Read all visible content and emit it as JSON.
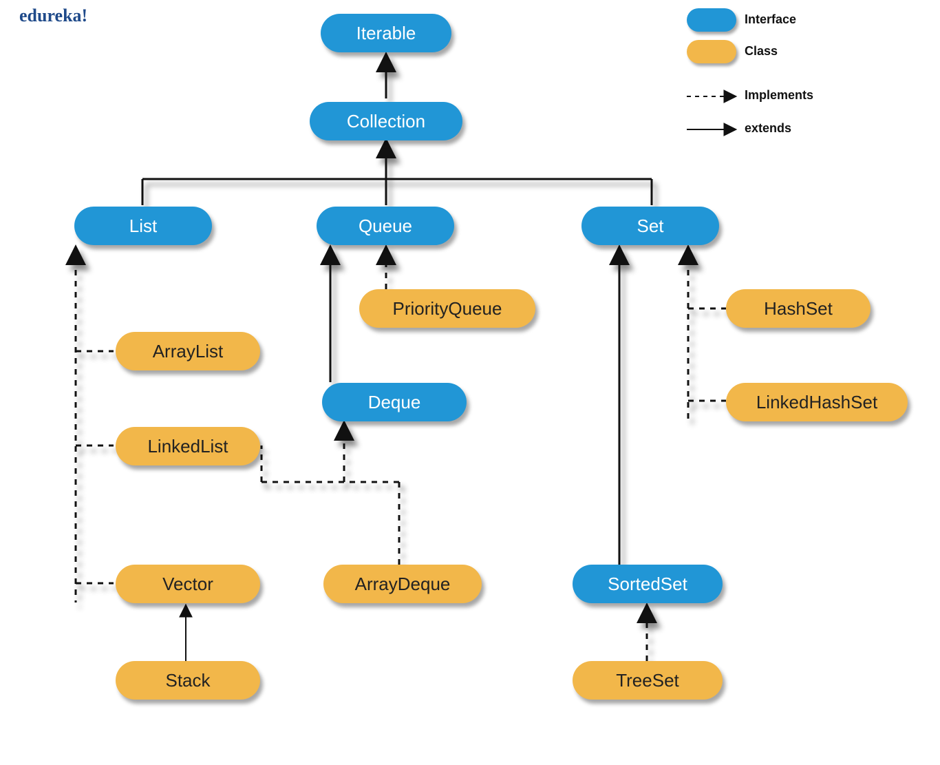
{
  "brand": "edureka!",
  "watermark_text": "edureka!",
  "legend": {
    "interface": "Interface",
    "class": "Class",
    "implements": "Implements",
    "extends": "extends"
  },
  "nodes": {
    "iterable": "Iterable",
    "collection": "Collection",
    "list": "List",
    "queue": "Queue",
    "set": "Set",
    "arraylist": "ArrayList",
    "linkedlist": "LinkedList",
    "vector": "Vector",
    "stack": "Stack",
    "priorityqueue": "PriorityQueue",
    "deque": "Deque",
    "arraydeque": "ArrayDeque",
    "sortedset": "SortedSet",
    "hashset": "HashSet",
    "linkedhashset": "LinkedHashSet",
    "treeset": "TreeSet"
  },
  "colors": {
    "interface": "#2196d6",
    "class": "#f2b74a"
  },
  "edges": [
    {
      "from": "collection",
      "to": "iterable",
      "kind": "extends"
    },
    {
      "from": "list",
      "to": "collection",
      "kind": "extends"
    },
    {
      "from": "queue",
      "to": "collection",
      "kind": "extends"
    },
    {
      "from": "set",
      "to": "collection",
      "kind": "extends"
    },
    {
      "from": "arraylist",
      "to": "list",
      "kind": "implements"
    },
    {
      "from": "linkedlist",
      "to": "list",
      "kind": "implements"
    },
    {
      "from": "vector",
      "to": "list",
      "kind": "implements"
    },
    {
      "from": "stack",
      "to": "vector",
      "kind": "extends"
    },
    {
      "from": "priorityqueue",
      "to": "queue",
      "kind": "implements"
    },
    {
      "from": "deque",
      "to": "queue",
      "kind": "extends"
    },
    {
      "from": "linkedlist",
      "to": "deque",
      "kind": "implements"
    },
    {
      "from": "arraydeque",
      "to": "deque",
      "kind": "implements"
    },
    {
      "from": "hashset",
      "to": "set",
      "kind": "implements"
    },
    {
      "from": "linkedhashset",
      "to": "set",
      "kind": "implements"
    },
    {
      "from": "sortedset",
      "to": "set",
      "kind": "extends"
    },
    {
      "from": "treeset",
      "to": "sortedset",
      "kind": "implements"
    }
  ]
}
